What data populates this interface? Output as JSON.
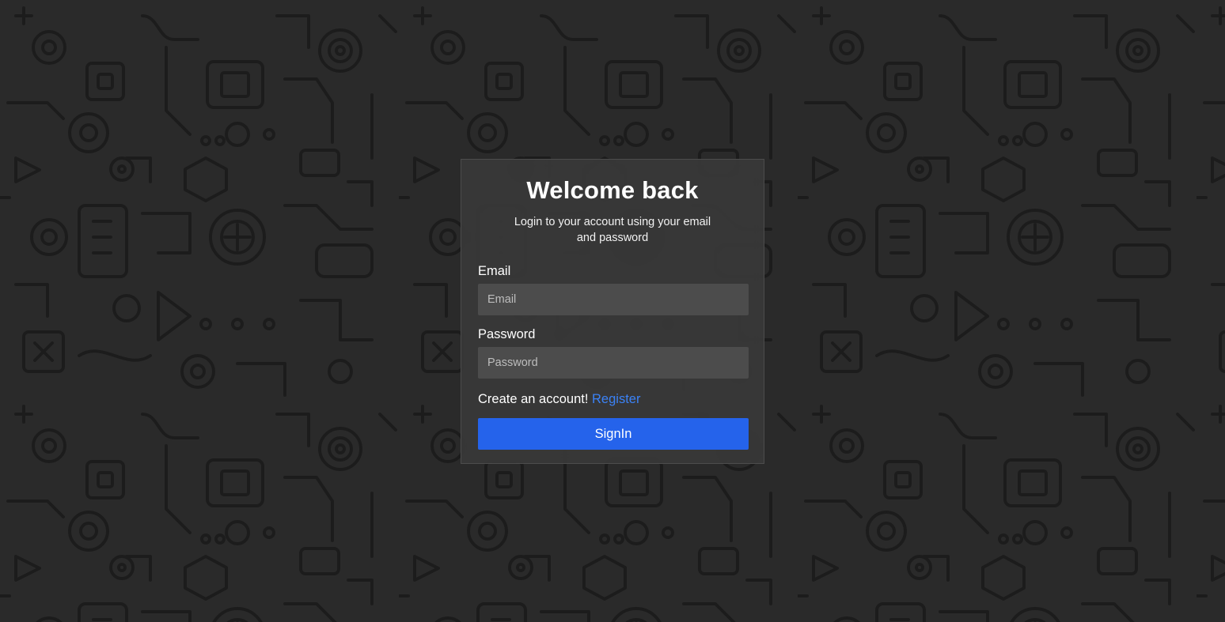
{
  "login": {
    "title": "Welcome back",
    "subtitle": "Login to your account using your email and password",
    "email_label": "Email",
    "email_placeholder": "Email",
    "email_value": "",
    "password_label": "Password",
    "password_placeholder": "Password",
    "password_value": "",
    "register_prompt": "Create an account!",
    "register_link": "Register",
    "signin_label": "SignIn"
  },
  "colors": {
    "background": "#2a2a2a",
    "pattern_stroke": "#1c1c1c",
    "card": "#3a3a3a",
    "input": "#545454",
    "accent": "#2563eb",
    "link": "#3b82f6"
  },
  "icons": [
    "circuit-pattern-background"
  ]
}
